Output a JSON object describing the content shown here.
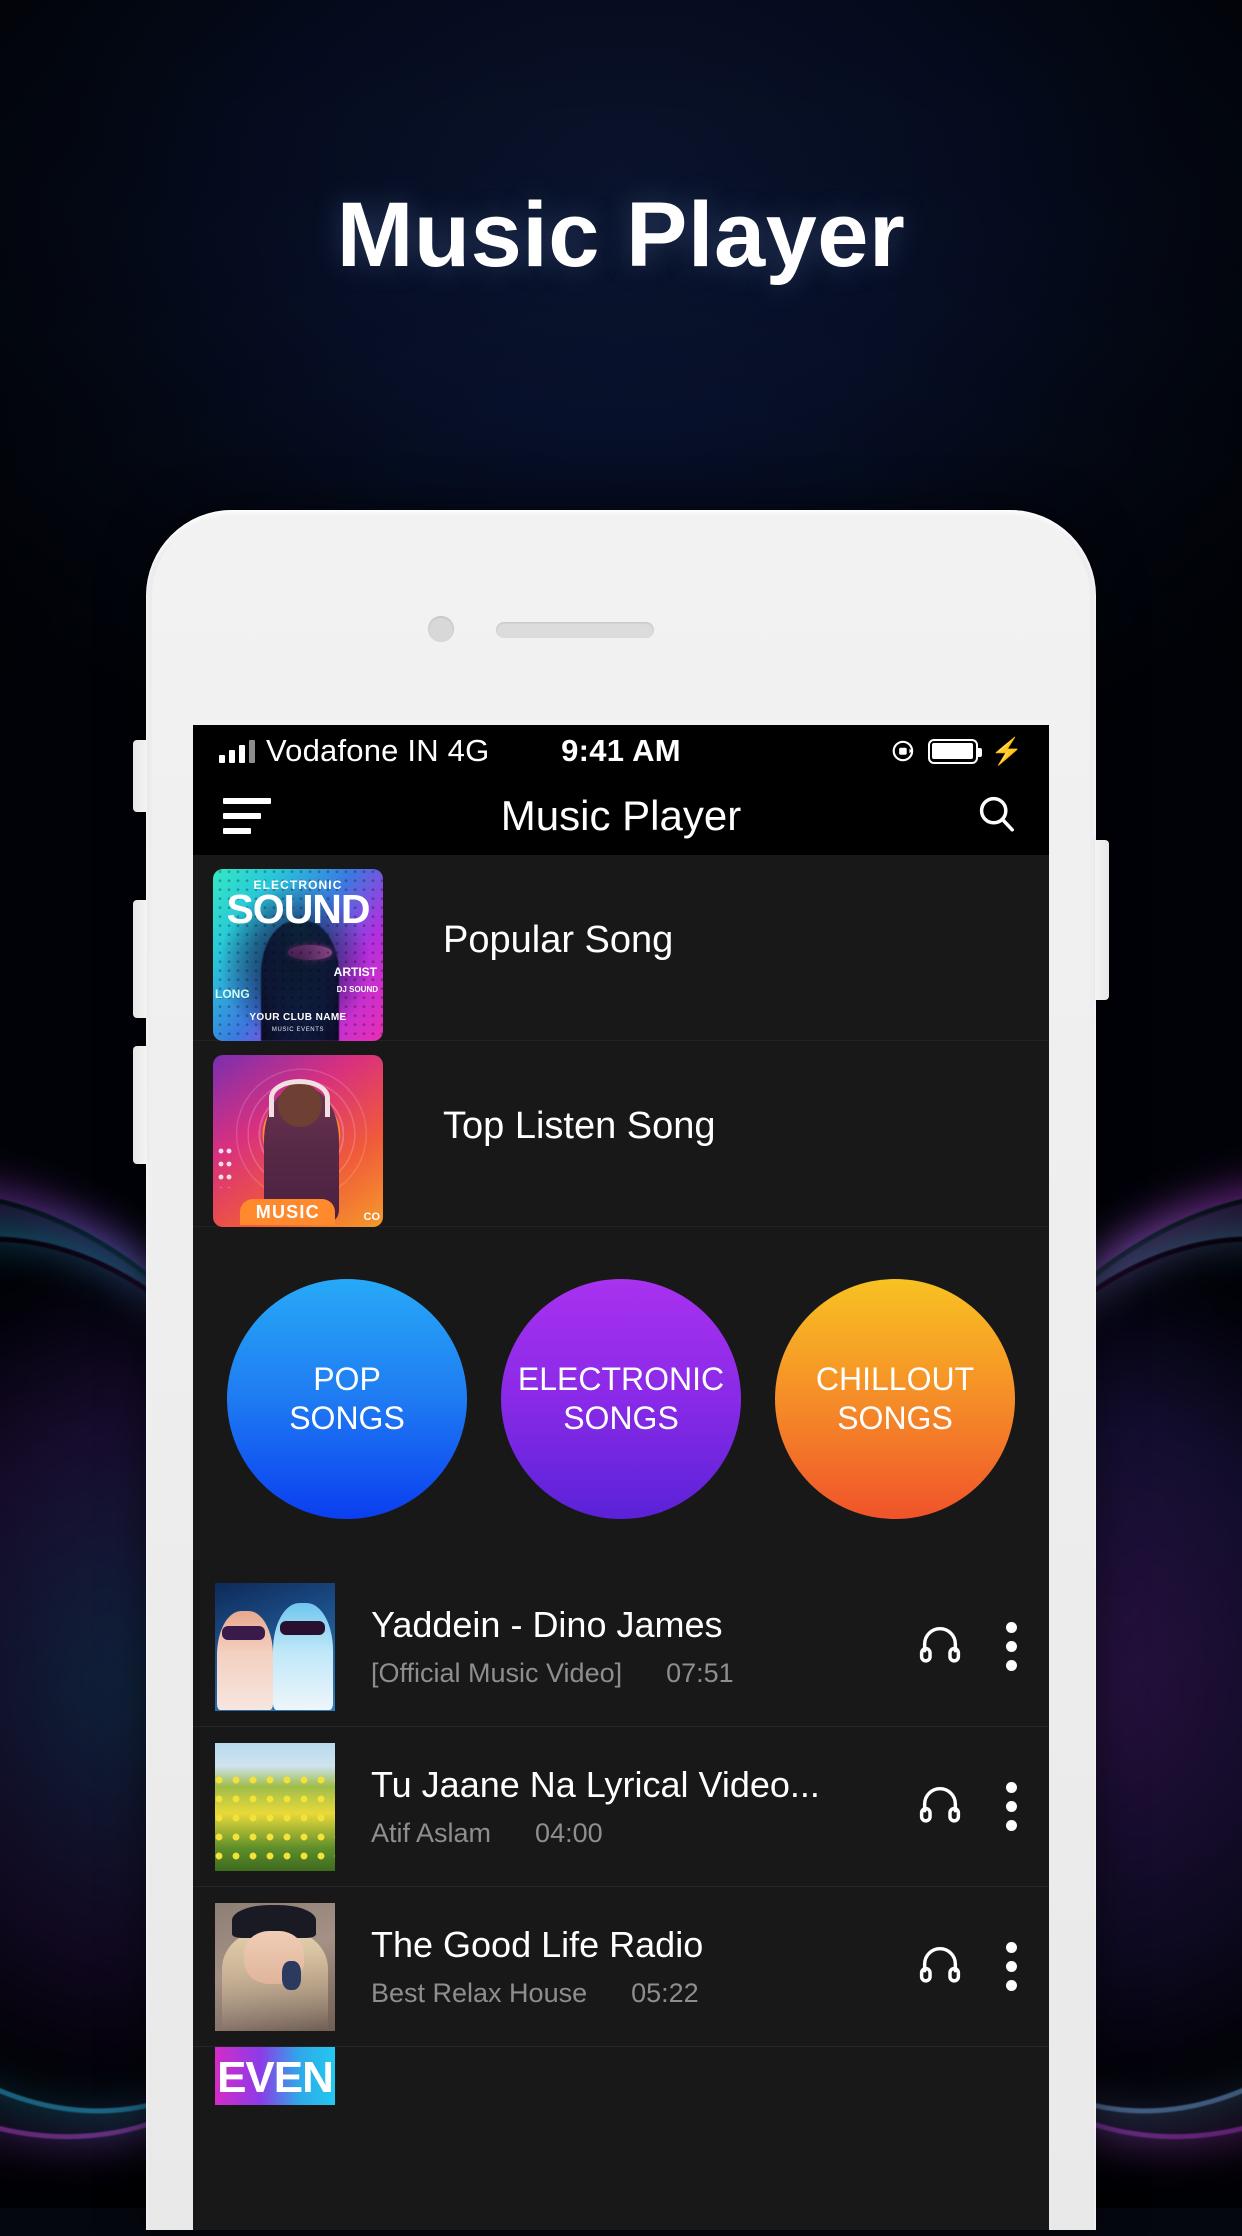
{
  "hero": {
    "title": "Music Player"
  },
  "status_bar": {
    "carrier": "Vodafone IN 4G",
    "time": "9:41 AM",
    "signal_icon": "signal-bars-icon",
    "rotation_lock_icon": "rotation-lock-icon",
    "battery_icon": "battery-icon",
    "charging_icon": "charging-bolt-icon",
    "bolt_glyph": "⚡"
  },
  "app_bar": {
    "title": "Music Player",
    "menu_icon": "hamburger-menu-icon",
    "search_icon": "search-icon"
  },
  "featured": [
    {
      "label": "Popular Song",
      "art_name": "electronic-sound-album-art",
      "art_text": {
        "kicker": "ELECTRONIC",
        "title": "SOUND",
        "artist_label": "ARTIST",
        "artist_name": "DJ SOUND",
        "club": "YOUR CLUB NAME",
        "sub": "MUSIC EVENTS",
        "corner": "LONG"
      }
    },
    {
      "label": "Top Listen Song",
      "art_name": "music-top-listen-album-art",
      "art_text": {
        "badge": "MUSIC",
        "corner": "CO"
      }
    }
  ],
  "categories": [
    {
      "line1": "POP",
      "line2": "SONGS",
      "color_from": "#27a9f7",
      "color_to": "#0b3ef0"
    },
    {
      "line1": "ELECTRONIC",
      "line2": "SONGS",
      "color_from": "#a832ef",
      "color_to": "#5a22d8"
    },
    {
      "line1": "CHILLOUT",
      "line2": "SONGS",
      "color_from": "#f8c222",
      "color_to": "#f0532a"
    }
  ],
  "songs": [
    {
      "title": "Yaddein - Dino James",
      "artist": "[Official Music Video]",
      "duration": "07:51",
      "thumb_name": "yaddein-thumbnail",
      "headphone_icon": "headphone-icon",
      "overflow_icon": "kebab-menu-icon"
    },
    {
      "title": "Tu Jaane Na Lyrical Video...",
      "artist": "Atif Aslam",
      "duration": "04:00",
      "thumb_name": "tu-jaane-na-thumbnail",
      "headphone_icon": "headphone-icon",
      "overflow_icon": "kebab-menu-icon"
    },
    {
      "title": "The Good Life Radio",
      "artist": "Best Relax House",
      "duration": "05:22",
      "thumb_name": "good-life-radio-thumbnail",
      "headphone_icon": "headphone-icon",
      "overflow_icon": "kebab-menu-icon"
    }
  ],
  "partial_song": {
    "thumb_text": "EVEN",
    "thumb_name": "event-thumbnail"
  },
  "theme": {
    "screen_bg": "#181818",
    "bar_bg": "#000000",
    "text_primary": "#ffffff",
    "text_secondary": "#8e8e8e",
    "neon_magenta": "#e74bff",
    "neon_cyan": "#2fd8f5"
  }
}
